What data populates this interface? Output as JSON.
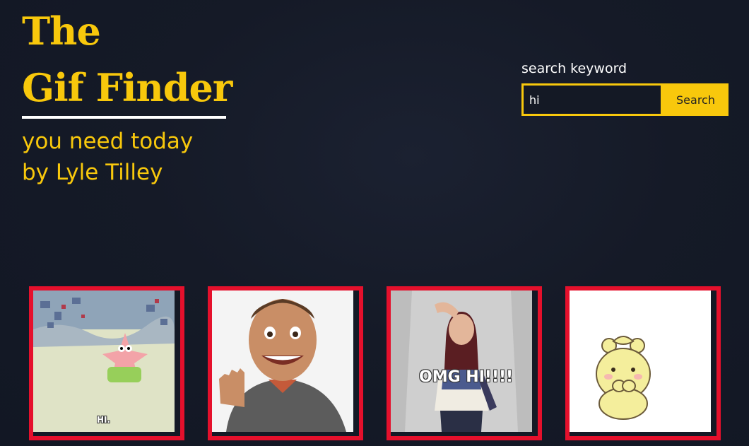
{
  "header": {
    "title_line1": "The",
    "title_line2": "Gif Finder",
    "tagline_line1": "you need today",
    "tagline_line2": "by Lyle Tilley"
  },
  "search": {
    "label": "search keyword",
    "value": "hi",
    "button_label": "Search"
  },
  "results": [
    {
      "caption": "HI."
    },
    {
      "caption": ""
    },
    {
      "caption": "OMG HI!!!!"
    },
    {
      "caption": ""
    }
  ],
  "colors": {
    "accent": "#f8c80c",
    "card_border": "#e5102c",
    "background": "#141925"
  }
}
